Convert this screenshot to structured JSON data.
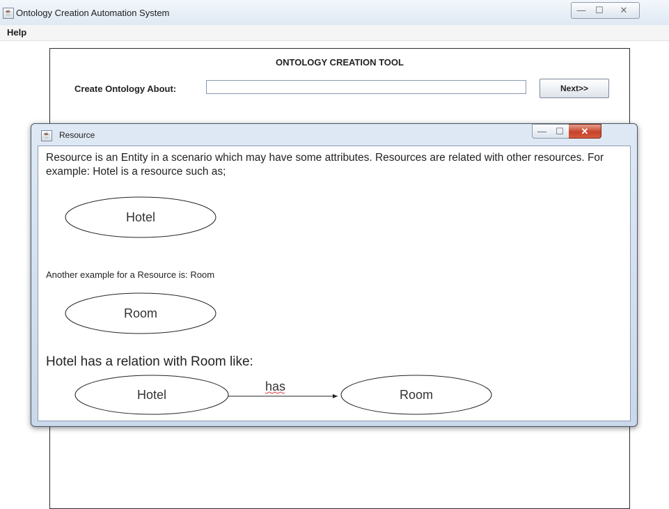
{
  "window": {
    "title": "Ontology Creation Automation System",
    "app_icon": "java-icon",
    "controls": {
      "minimize": "—",
      "maximize": "☐",
      "close": "✕"
    }
  },
  "menubar": {
    "items": [
      "Help"
    ]
  },
  "main": {
    "tool_title": "ONTOLOGY CREATION TOOL",
    "create_label": "Create Ontology About:",
    "create_input_value": "",
    "next_button": "Next>>"
  },
  "dialog": {
    "title": "Resource",
    "app_icon": "java-icon",
    "controls": {
      "minimize": "—",
      "maximize": "☐",
      "close": "✕"
    },
    "intro": "Resource is an Entity in a scenario which may  have some attributes. Resources are related with other resources. For example: Hotel is a resource such as;",
    "hotel_label": "Hotel",
    "example_text": "Another example for a Resource is: Room",
    "room_label": "Room",
    "relation_text": "Hotel has a relation with Room like:",
    "relation": {
      "from": "Hotel",
      "edge": "has",
      "to": "Room"
    }
  },
  "colors": {
    "titlebar": "#e6eef7",
    "dialog_frame": "#c9d8ea",
    "close_button": "#c7432b"
  }
}
